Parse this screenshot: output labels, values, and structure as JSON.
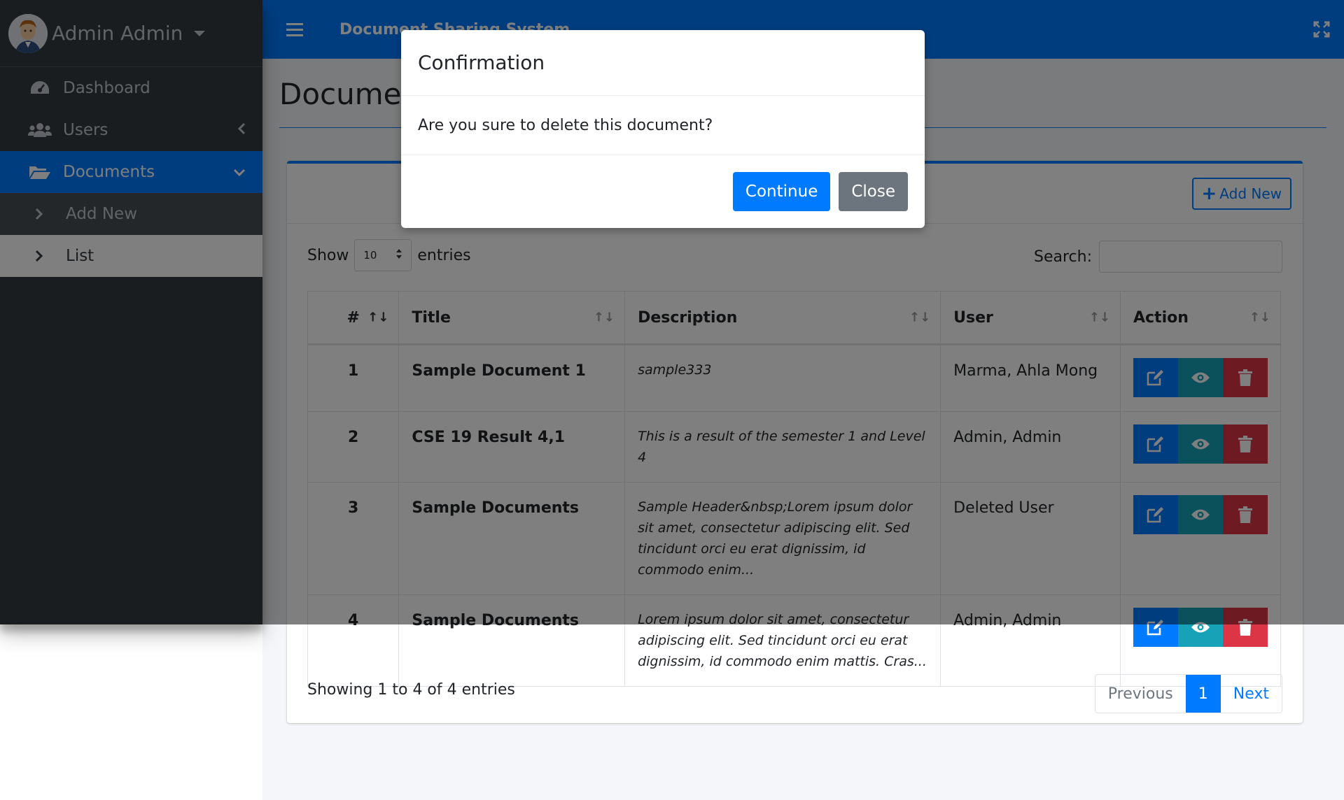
{
  "user": {
    "name": "Admin Admin"
  },
  "sidebar": {
    "items": [
      {
        "label": "Dashboard",
        "icon": "dashboard-icon"
      },
      {
        "label": "Users",
        "icon": "users-icon"
      },
      {
        "label": "Documents",
        "icon": "folder-open-icon"
      }
    ],
    "documents_sub": [
      {
        "label": "Add New"
      },
      {
        "label": "List"
      }
    ]
  },
  "header": {
    "title": "Document Sharing System"
  },
  "page": {
    "title": "Documents"
  },
  "card": {
    "add_new_label": "Add New"
  },
  "length_menu": {
    "show_label": "Show",
    "value": "10",
    "entries_label": "entries"
  },
  "search": {
    "label": "Search:",
    "value": ""
  },
  "table": {
    "columns": [
      "#",
      "Title",
      "Description",
      "User",
      "Action"
    ],
    "rows": [
      {
        "num": "1",
        "title": "Sample Document 1",
        "description": "sample333",
        "user": "Marma, Ahla Mong"
      },
      {
        "num": "2",
        "title": "CSE 19 Result 4,1",
        "description": "This is a result of the semester 1 and Level 4",
        "user": "Admin, Admin"
      },
      {
        "num": "3",
        "title": "Sample Documents",
        "description": "Sample Header&nbsp;Lorem ipsum dolor sit amet, consectetur adipiscing elit. Sed tincidunt orci eu erat dignissim, id commodo enim...",
        "user": "Deleted User"
      },
      {
        "num": "4",
        "title": "Sample Documents",
        "description": "Lorem ipsum dolor sit amet, consectetur adipiscing elit. Sed tincidunt orci eu erat dignissim, id commodo enim mattis. Cras...",
        "user": "Admin, Admin"
      }
    ]
  },
  "info": "Showing 1 to 4 of 4 entries",
  "pagination": {
    "previous": "Previous",
    "current": "1",
    "next": "Next"
  },
  "modal": {
    "title": "Confirmation",
    "message": "Are you sure to delete this document?",
    "continue_label": "Continue",
    "close_label": "Close"
  },
  "colors": {
    "primary": "#007bff",
    "info": "#17a2b8",
    "danger": "#dc3545",
    "secondary": "#6c757d",
    "sidebar": "#343a40"
  }
}
